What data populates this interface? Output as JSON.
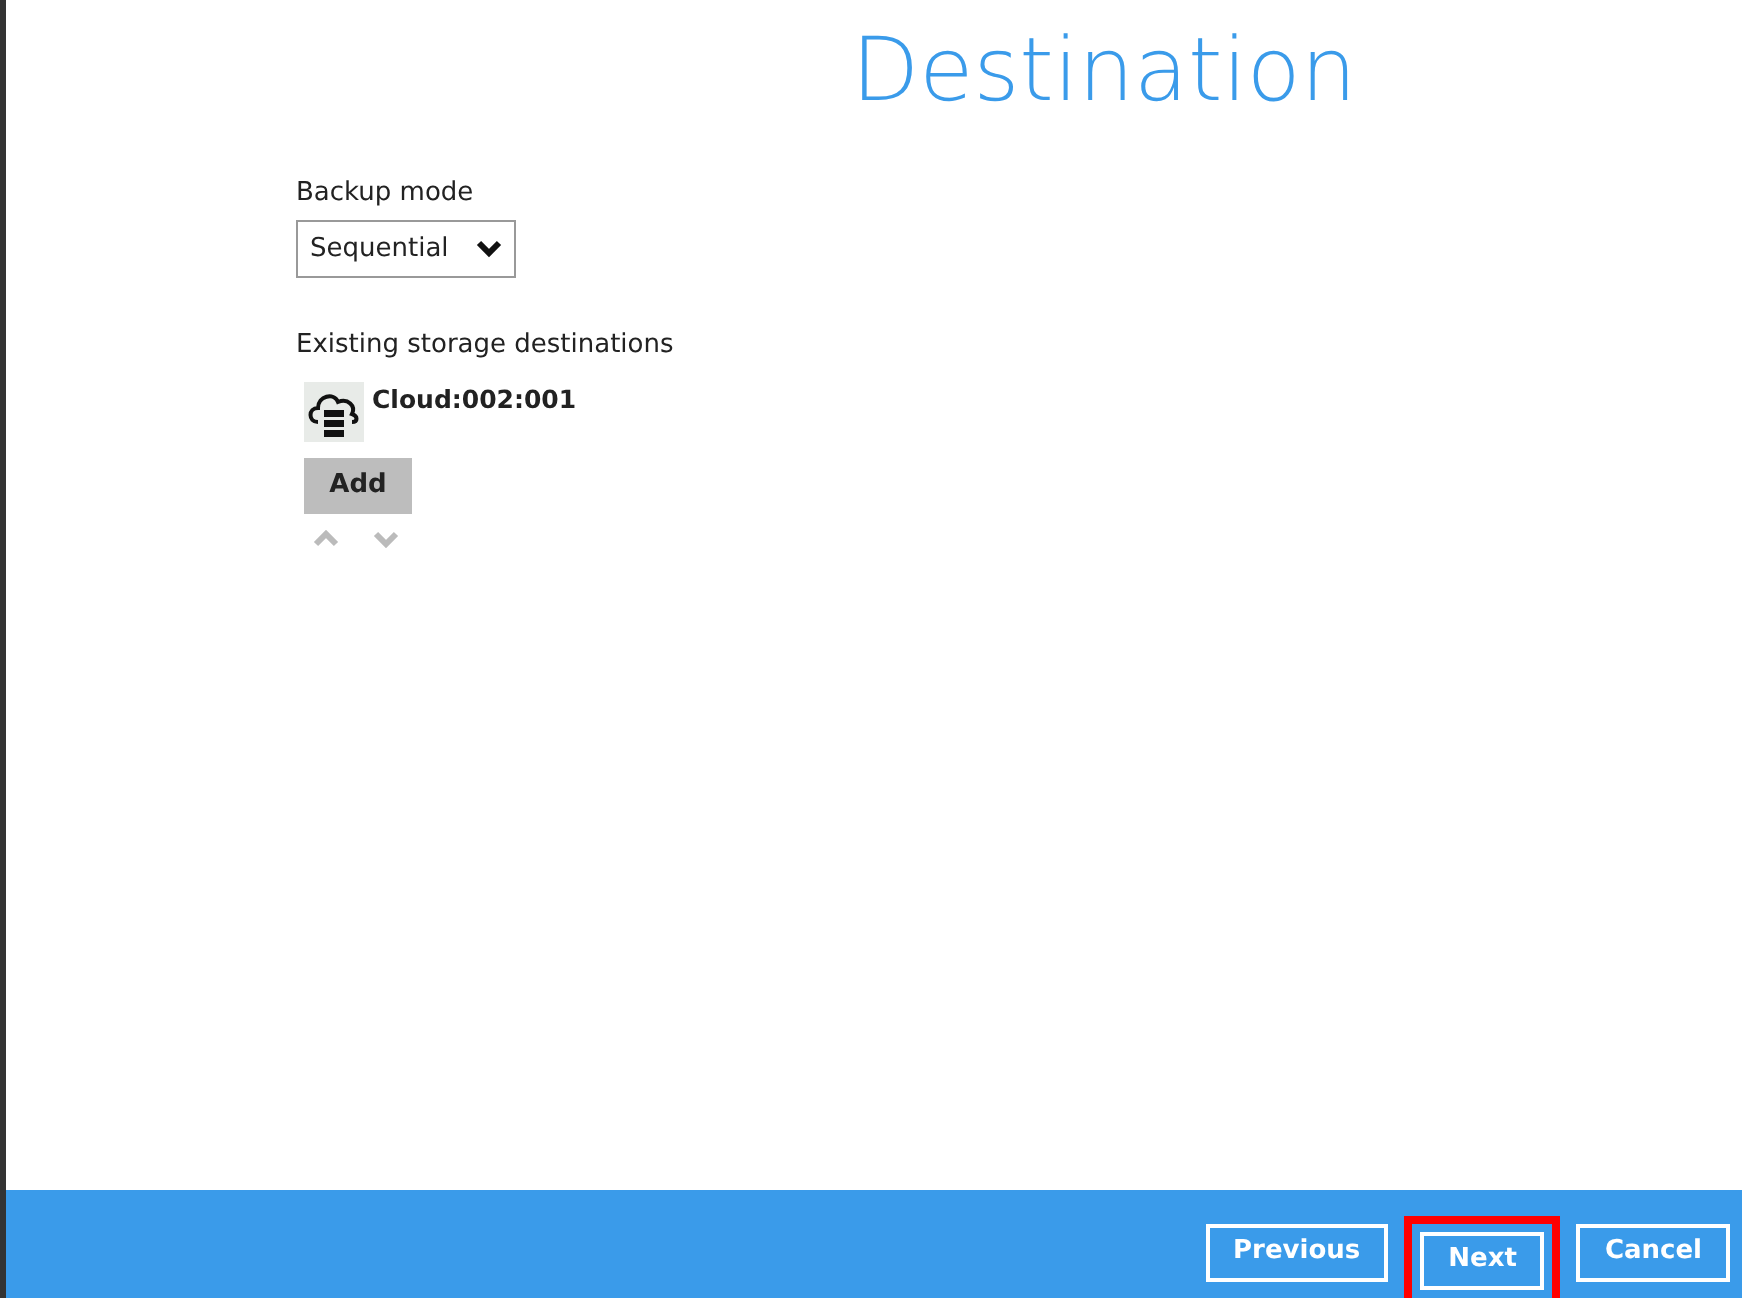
{
  "title": "Destination",
  "backup_mode": {
    "label": "Backup mode",
    "value": "Sequential"
  },
  "storage": {
    "label": "Existing storage destinations",
    "items": [
      {
        "name": "Cloud:002:001"
      }
    ]
  },
  "add_button": "Add",
  "footer_buttons": [
    {
      "label": "Previous",
      "highlighted": false
    },
    {
      "label": "Next",
      "highlighted": true
    },
    {
      "label": "Cancel",
      "highlighted": false
    }
  ]
}
